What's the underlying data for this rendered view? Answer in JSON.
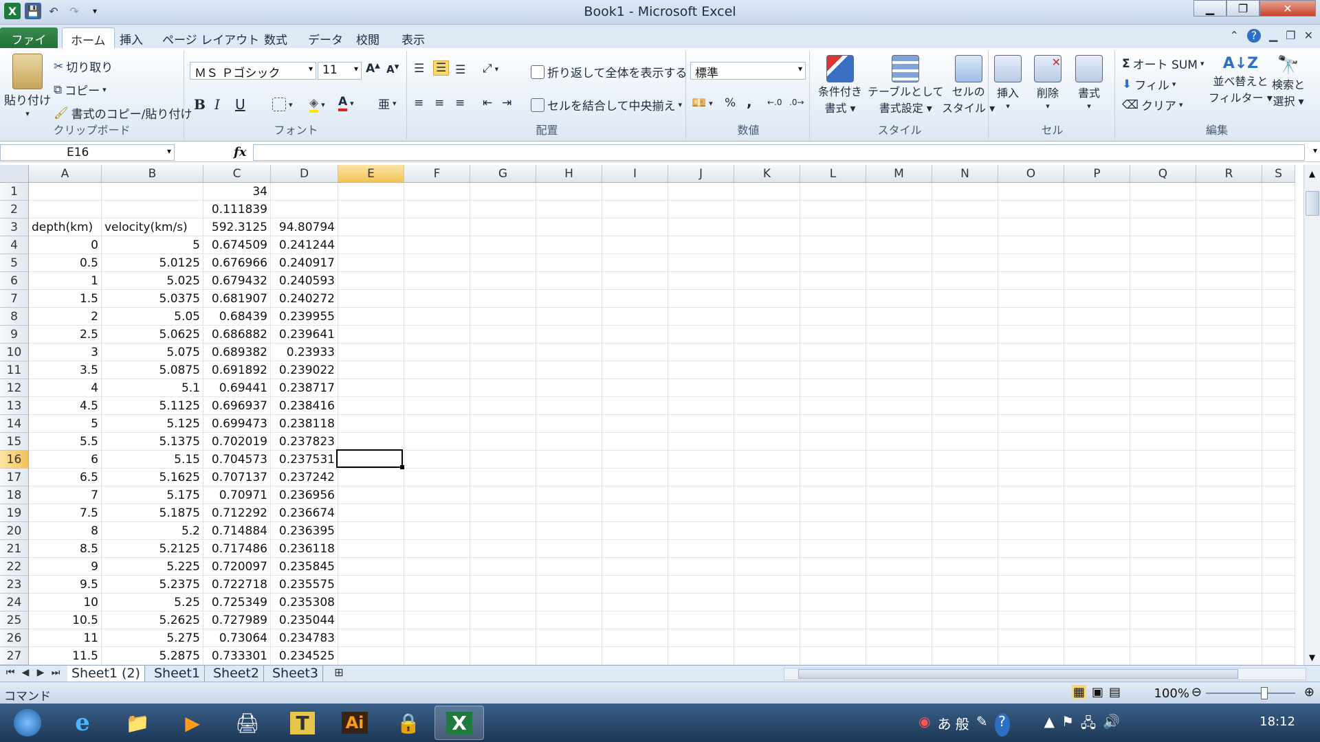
{
  "window": {
    "title": "Book1 - Microsoft Excel",
    "minimize": "▁",
    "restore": "❐",
    "close": "✕"
  },
  "tabs": {
    "file": "ファイル",
    "home": "ホーム",
    "insert": "挿入",
    "page_layout": "ページ レイアウト",
    "formulas": "数式",
    "data": "データ",
    "review": "校閲",
    "view": "表示"
  },
  "ribbon": {
    "clipboard": {
      "label": "クリップボード",
      "paste": "貼り付け",
      "cut": "切り取り",
      "copy": "コピー",
      "format_painter": "書式のコピー/貼り付け"
    },
    "font": {
      "label": "フォント",
      "name": "ＭＳ Ｐゴシック",
      "size": "11",
      "bold": "B",
      "italic": "I",
      "underline": "U"
    },
    "alignment": {
      "label": "配置",
      "wrap": "折り返して全体を表示する",
      "merge": "セルを結合して中央揃え"
    },
    "number": {
      "label": "数値",
      "format": "標準",
      "percent": "%",
      "comma": ","
    },
    "styles": {
      "label": "スタイル",
      "conditional_1": "条件付き",
      "conditional_2": "書式",
      "table_1": "テーブルとして",
      "table_2": "書式設定",
      "cell_1": "セルの",
      "cell_2": "スタイル"
    },
    "cells": {
      "label": "セル",
      "insert": "挿入",
      "delete": "削除",
      "format": "書式"
    },
    "editing": {
      "label": "編集",
      "autosum": "オート SUM",
      "fill": "フィル",
      "clear": "クリア",
      "sort_1": "並べ替えと",
      "sort_2": "フィルター",
      "find_1": "検索と",
      "find_2": "選択"
    }
  },
  "formula_bar": {
    "name_box": "E16",
    "fx": "fx",
    "value": ""
  },
  "grid": {
    "columns": [
      "A",
      "B",
      "C",
      "D",
      "E",
      "F",
      "G",
      "H",
      "I",
      "J",
      "K",
      "L",
      "M",
      "N",
      "O",
      "P",
      "Q",
      "R",
      "S"
    ],
    "selected_column": "E",
    "selected_row": 16,
    "rows": [
      {
        "n": 1,
        "A": "",
        "B": "",
        "C": "34",
        "D": ""
      },
      {
        "n": 2,
        "A": "",
        "B": "",
        "C": "0.111839",
        "D": ""
      },
      {
        "n": 3,
        "A": "depth(km)",
        "B": "velocity(km/s)",
        "C": "592.3125",
        "D": "94.80794"
      },
      {
        "n": 4,
        "A": "0",
        "B": "5",
        "C": "0.674509",
        "D": "0.241244"
      },
      {
        "n": 5,
        "A": "0.5",
        "B": "5.0125",
        "C": "0.676966",
        "D": "0.240917"
      },
      {
        "n": 6,
        "A": "1",
        "B": "5.025",
        "C": "0.679432",
        "D": "0.240593"
      },
      {
        "n": 7,
        "A": "1.5",
        "B": "5.0375",
        "C": "0.681907",
        "D": "0.240272"
      },
      {
        "n": 8,
        "A": "2",
        "B": "5.05",
        "C": "0.68439",
        "D": "0.239955"
      },
      {
        "n": 9,
        "A": "2.5",
        "B": "5.0625",
        "C": "0.686882",
        "D": "0.239641"
      },
      {
        "n": 10,
        "A": "3",
        "B": "5.075",
        "C": "0.689382",
        "D": "0.23933"
      },
      {
        "n": 11,
        "A": "3.5",
        "B": "5.0875",
        "C": "0.691892",
        "D": "0.239022"
      },
      {
        "n": 12,
        "A": "4",
        "B": "5.1",
        "C": "0.69441",
        "D": "0.238717"
      },
      {
        "n": 13,
        "A": "4.5",
        "B": "5.1125",
        "C": "0.696937",
        "D": "0.238416"
      },
      {
        "n": 14,
        "A": "5",
        "B": "5.125",
        "C": "0.699473",
        "D": "0.238118"
      },
      {
        "n": 15,
        "A": "5.5",
        "B": "5.1375",
        "C": "0.702019",
        "D": "0.237823"
      },
      {
        "n": 16,
        "A": "6",
        "B": "5.15",
        "C": "0.704573",
        "D": "0.237531"
      },
      {
        "n": 17,
        "A": "6.5",
        "B": "5.1625",
        "C": "0.707137",
        "D": "0.237242"
      },
      {
        "n": 18,
        "A": "7",
        "B": "5.175",
        "C": "0.70971",
        "D": "0.236956"
      },
      {
        "n": 19,
        "A": "7.5",
        "B": "5.1875",
        "C": "0.712292",
        "D": "0.236674"
      },
      {
        "n": 20,
        "A": "8",
        "B": "5.2",
        "C": "0.714884",
        "D": "0.236395"
      },
      {
        "n": 21,
        "A": "8.5",
        "B": "5.2125",
        "C": "0.717486",
        "D": "0.236118"
      },
      {
        "n": 22,
        "A": "9",
        "B": "5.225",
        "C": "0.720097",
        "D": "0.235845"
      },
      {
        "n": 23,
        "A": "9.5",
        "B": "5.2375",
        "C": "0.722718",
        "D": "0.235575"
      },
      {
        "n": 24,
        "A": "10",
        "B": "5.25",
        "C": "0.725349",
        "D": "0.235308"
      },
      {
        "n": 25,
        "A": "10.5",
        "B": "5.2625",
        "C": "0.727989",
        "D": "0.235044"
      },
      {
        "n": 26,
        "A": "11",
        "B": "5.275",
        "C": "0.73064",
        "D": "0.234783"
      },
      {
        "n": 27,
        "A": "11.5",
        "B": "5.2875",
        "C": "0.733301",
        "D": "0.234525"
      }
    ]
  },
  "sheets": [
    "Sheet1 (2)",
    "Sheet1",
    "Sheet2",
    "Sheet3"
  ],
  "active_sheet": "Sheet1 (2)",
  "status": {
    "mode": "コマンド",
    "zoom": "100%"
  },
  "taskbar": {
    "ime": "あ 般",
    "clock": "18:12"
  }
}
